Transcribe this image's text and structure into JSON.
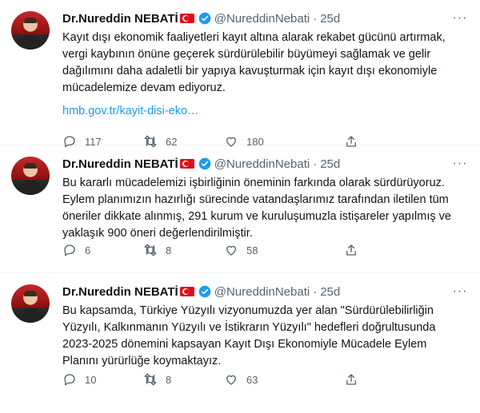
{
  "tweets": [
    {
      "name": "Dr.Nureddin NEBATİ",
      "handle": "@NureddinNebati",
      "separator": "·",
      "time": "25d",
      "text": "Kayıt dışı ekonomik faaliyetleri kayıt altına alarak rekabet gücünü artırmak,\nvergi kaybının önüne geçerek sürdürülebilir büyümeyi sağlamak ve gelir\ndağılımını daha adaletli bir yapıya kavuşturmak için kayıt dışı ekonomiyle\nmücadelemize devam ediyoruz.",
      "link": "hmb.gov.tr/kayit-disi-eko…",
      "replies": "117",
      "retweets": "62",
      "likes": "180"
    },
    {
      "name": "Dr.Nureddin NEBATİ",
      "handle": "@NureddinNebati",
      "separator": "·",
      "time": "25d",
      "text": "Bu kararlı mücadelemizi işbirliğinin öneminin farkında olarak sürdürüyoruz.\nEylem planımızın hazırlığı sürecinde vatandaşlarımız tarafından iletilen tüm\nöneriler dikkate alınmış, 291 kurum ve kuruluşumuzla istişareler yapılmış ve\nyaklaşık 900 öneri değerlendirilmiştir.",
      "link": "",
      "replies": "6",
      "retweets": "8",
      "likes": "58"
    },
    {
      "name": "Dr.Nureddin NEBATİ",
      "handle": "@NureddinNebati",
      "separator": "·",
      "time": "25d",
      "text": "Bu kapsamda, Türkiye Yüzyılı vizyonumuzda yer alan \"Sürdürülebilirliğin\nYüzyılı, Kalkınmanın Yüzyılı ve İstikrarın Yüzyılı\" hedefleri doğrultusunda\n2023-2025 dönemini kapsayan Kayıt Dışı Ekonomiyle Mücadele Eylem\nPlanını yürürlüğe koymaktayız.",
      "link": "",
      "replies": "10",
      "retweets": "8",
      "likes": "63"
    }
  ],
  "more_label": "···",
  "colors": {
    "link": "#1d9bf0",
    "muted": "#536471",
    "verified": "#1d9bf0",
    "flag": "#e30a17"
  },
  "icons": [
    "reply-icon",
    "retweet-icon",
    "like-icon",
    "share-icon",
    "verified-badge-icon",
    "turkey-flag-icon"
  ]
}
